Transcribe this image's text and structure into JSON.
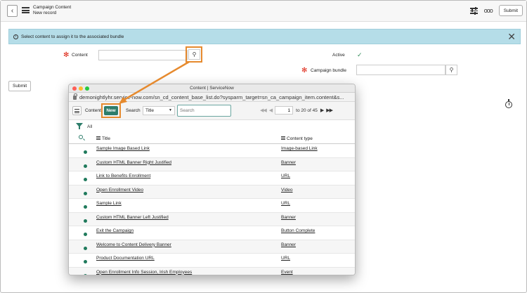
{
  "header": {
    "title": "Campaign Content",
    "subtitle": "New record",
    "submit_label": "Submit",
    "back_icon": "chevron-left",
    "more_icon": "ooo"
  },
  "banner": {
    "info_glyph": "i",
    "text": "Select content to assign it to the associated bundle",
    "close_glyph": "✕"
  },
  "form": {
    "content_label": "Content",
    "active_label": "Active",
    "active_checked": true,
    "campaign_bundle_label": "Campaign bundle",
    "required_glyph": "✻",
    "submit_label": "Submit"
  },
  "popup": {
    "window_title": "Content | ServiceNow",
    "url": "demonightlyhr.service-now.com/sn_cd_content_base_list.do?sysparm_target=sn_ca_campaign_item.content&s...",
    "toolbar": {
      "list_label": "Content",
      "new_label": "New",
      "search_label": "Search",
      "search_field_selected": "Title",
      "search_placeholder": "Search",
      "page_first": "◀◀",
      "page_prev": "◀",
      "page_input": "1",
      "page_range": "to 20 of 45",
      "page_next": "▶",
      "page_last": "▶▶"
    },
    "filter_label": "All",
    "columns": {
      "title": "Title",
      "content_type": "Content type"
    },
    "rows": [
      {
        "title": "Sample Image Based Link",
        "type": "Image-based Link"
      },
      {
        "title": "Custom HTML Banner Right Justified",
        "type": "Banner"
      },
      {
        "title": "Link to Benefits Enrollment",
        "type": "URL"
      },
      {
        "title": "Open Enrollment Video",
        "type": "Video"
      },
      {
        "title": "Sample Link",
        "type": "URL"
      },
      {
        "title": "Custom HTML Banner Left Justified",
        "type": "Banner"
      },
      {
        "title": "Exit the Campaign",
        "type": "Button Complete"
      },
      {
        "title": "Welcome to Content Delivery Banner",
        "type": "Banner"
      },
      {
        "title": "Product Documentation URL",
        "type": "URL"
      },
      {
        "title": "Open Enrollment Info Session, Irish Employees",
        "type": "Event"
      }
    ]
  },
  "colors": {
    "accent": "#2e7d6b",
    "highlight": "#e68a2e",
    "banner_bg": "#b5dde8",
    "required": "#d21111"
  }
}
